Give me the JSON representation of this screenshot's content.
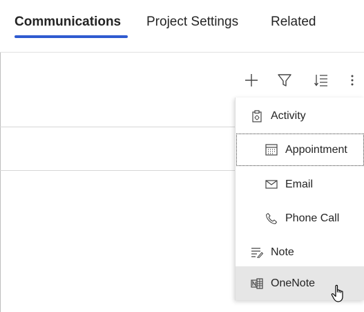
{
  "tabs": [
    {
      "label": "Communications",
      "active": true
    },
    {
      "label": "Project Settings",
      "active": false
    },
    {
      "label": "Related",
      "active": false
    }
  ],
  "toolbar": {
    "add_icon": "plus-icon",
    "filter_icon": "filter-icon",
    "sort_icon": "sort-icon",
    "more_icon": "more-vertical-icon"
  },
  "menu": {
    "items": [
      {
        "label": "Activity",
        "icon": "clipboard-icon",
        "level": 1
      },
      {
        "label": "Appointment",
        "icon": "calendar-icon",
        "level": 2,
        "focused": true
      },
      {
        "label": "Email",
        "icon": "mail-icon",
        "level": 2
      },
      {
        "label": "Phone Call",
        "icon": "phone-icon",
        "level": 2
      },
      {
        "label": "Note",
        "icon": "note-icon",
        "level": 1
      },
      {
        "label": "OneNote",
        "icon": "onenote-icon",
        "level": 1,
        "hovered": true
      }
    ]
  },
  "colors": {
    "accent": "#2f5bd0",
    "hover_bg": "#e6e6e6",
    "text": "#242424"
  }
}
